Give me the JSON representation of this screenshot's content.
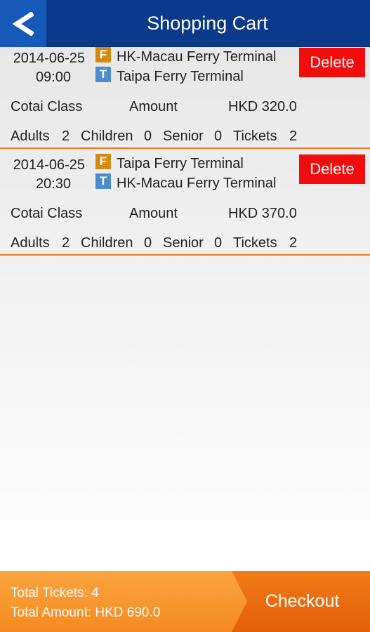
{
  "header": {
    "title": "Shopping Cart",
    "back_icon": "chevron-left-icon"
  },
  "colors": {
    "header_bg": "#0b3a8a",
    "back_bg": "#1659b8",
    "delete_bg": "#f20d0d",
    "divider": "#f07a1f",
    "footer_bg": "#f8961f",
    "checkout_bg": "#e86a0e",
    "from_badge": "#d38a12",
    "to_badge": "#4a8ccc"
  },
  "cart": {
    "items": [
      {
        "date": "2014-06-25",
        "time": "09:00",
        "from_badge": "F",
        "to_badge": "T",
        "from": "HK-Macau Ferry Terminal",
        "to": "Taipa Ferry Terminal",
        "delete_label": "Delete",
        "class": "Cotai Class",
        "amount_label": "Amount",
        "amount": "HKD 320.0",
        "adults_label": "Adults",
        "adults": "2",
        "children_label": "Children",
        "children": "0",
        "senior_label": "Senior",
        "senior": "0",
        "tickets_label": "Tickets",
        "tickets": "2"
      },
      {
        "date": "2014-06-25",
        "time": "20:30",
        "from_badge": "F",
        "to_badge": "T",
        "from": "Taipa Ferry Terminal",
        "to": "HK-Macau Ferry Terminal",
        "delete_label": "Delete",
        "class": "Cotai Class",
        "amount_label": "Amount",
        "amount": "HKD 370.0",
        "adults_label": "Adults",
        "adults": "2",
        "children_label": "Children",
        "children": "0",
        "senior_label": "Senior",
        "senior": "0",
        "tickets_label": "Tickets",
        "tickets": "2"
      }
    ]
  },
  "footer": {
    "total_tickets": "Total Tickets: 4",
    "total_amount": "Total Amount: HKD 690.0",
    "checkout_label": "Checkout"
  }
}
